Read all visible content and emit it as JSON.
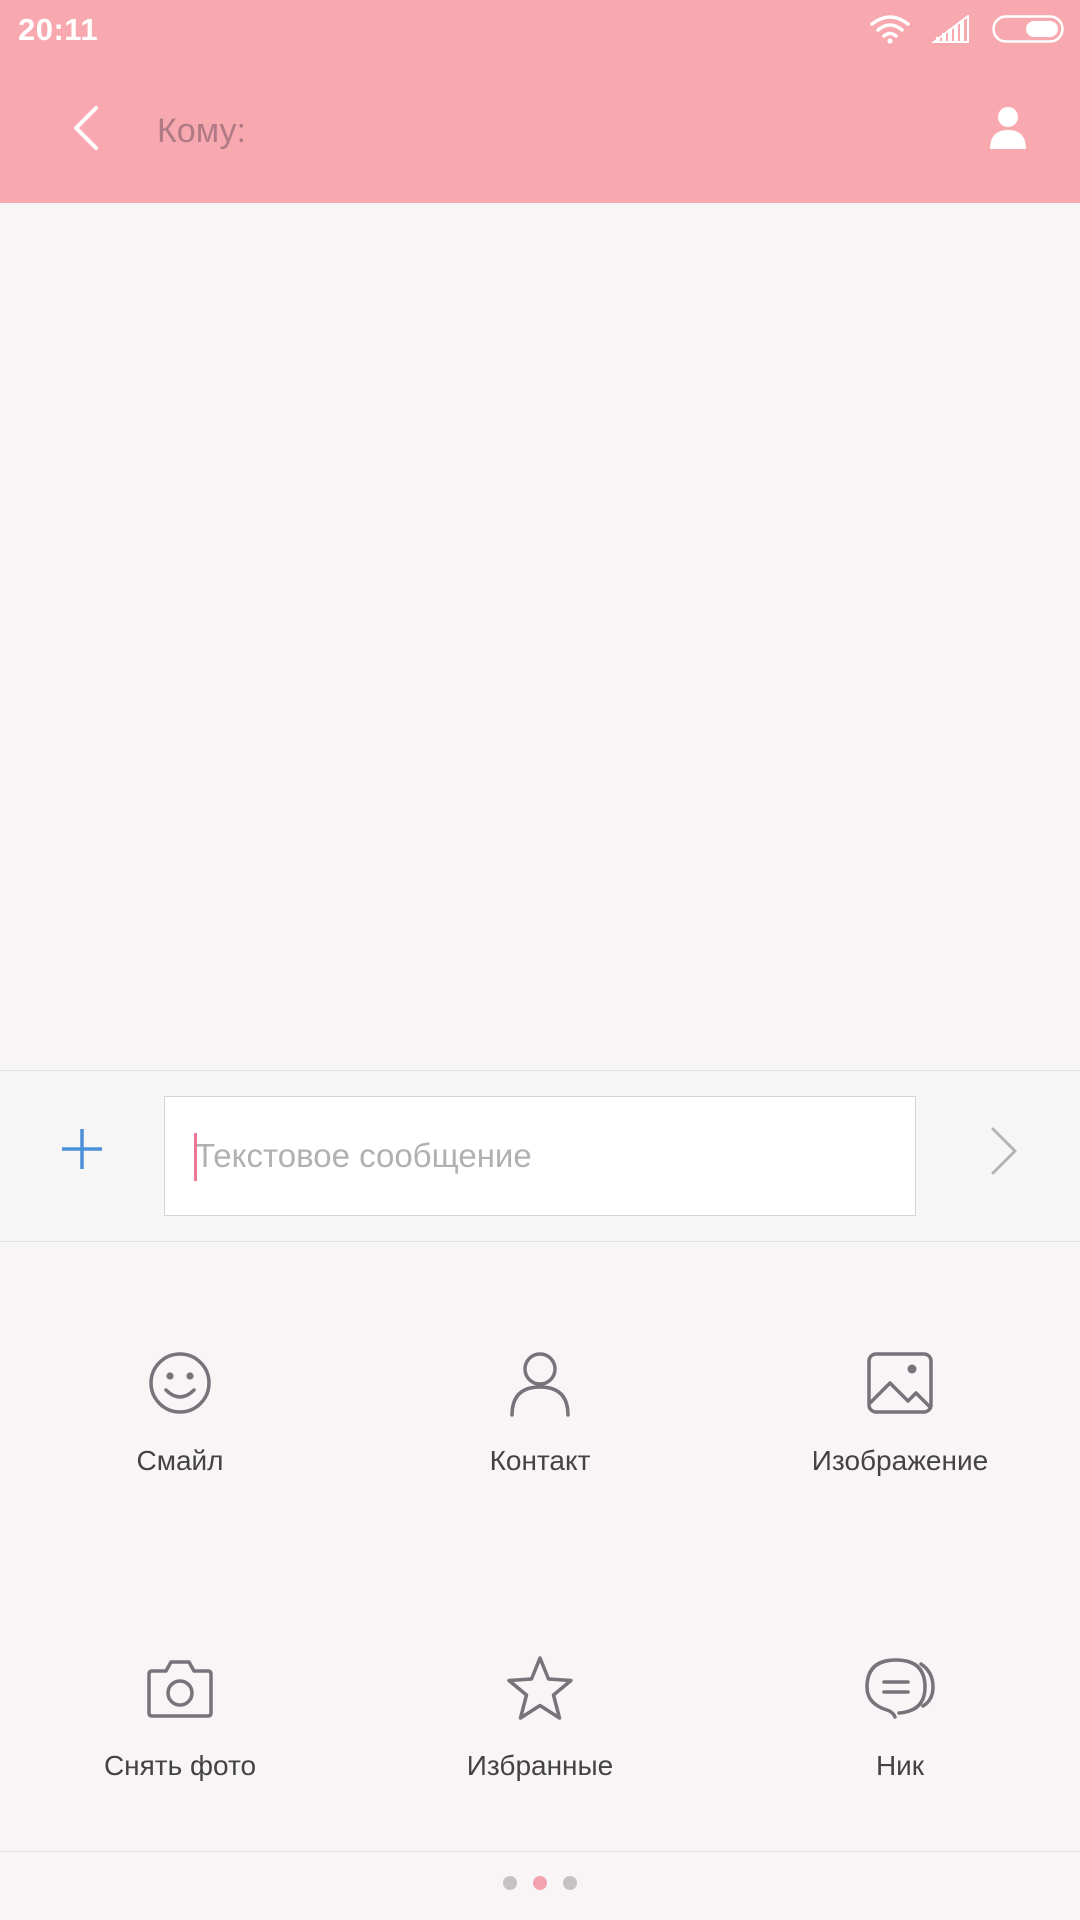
{
  "status_bar": {
    "time": "20:11",
    "icons": [
      "wifi-icon",
      "signal-icon",
      "battery-icon"
    ]
  },
  "header": {
    "back_icon": "chevron-left-icon",
    "to_label": "Кому:",
    "contact_icon": "person-icon"
  },
  "compose": {
    "add_icon": "plus-icon",
    "placeholder": "Текстовое сообщение",
    "value": "",
    "send_icon": "chevron-right-icon"
  },
  "attachments": [
    {
      "icon": "smiley-icon",
      "label": "Смайл"
    },
    {
      "icon": "contact-icon",
      "label": "Контакт"
    },
    {
      "icon": "image-icon",
      "label": "Изображение"
    },
    {
      "icon": "camera-icon",
      "label": "Снять фото"
    },
    {
      "icon": "star-icon",
      "label": "Избранные"
    },
    {
      "icon": "chat-bubble-icon",
      "label": "Ник"
    }
  ],
  "pager": {
    "pages": 3,
    "current_page": 2
  },
  "colors": {
    "header_bg": "#f8a9b0",
    "accent_blue": "#4a90d9",
    "caret": "#e97892",
    "icon_gray": "#77737a",
    "active_dot": "#f3a3ae"
  }
}
